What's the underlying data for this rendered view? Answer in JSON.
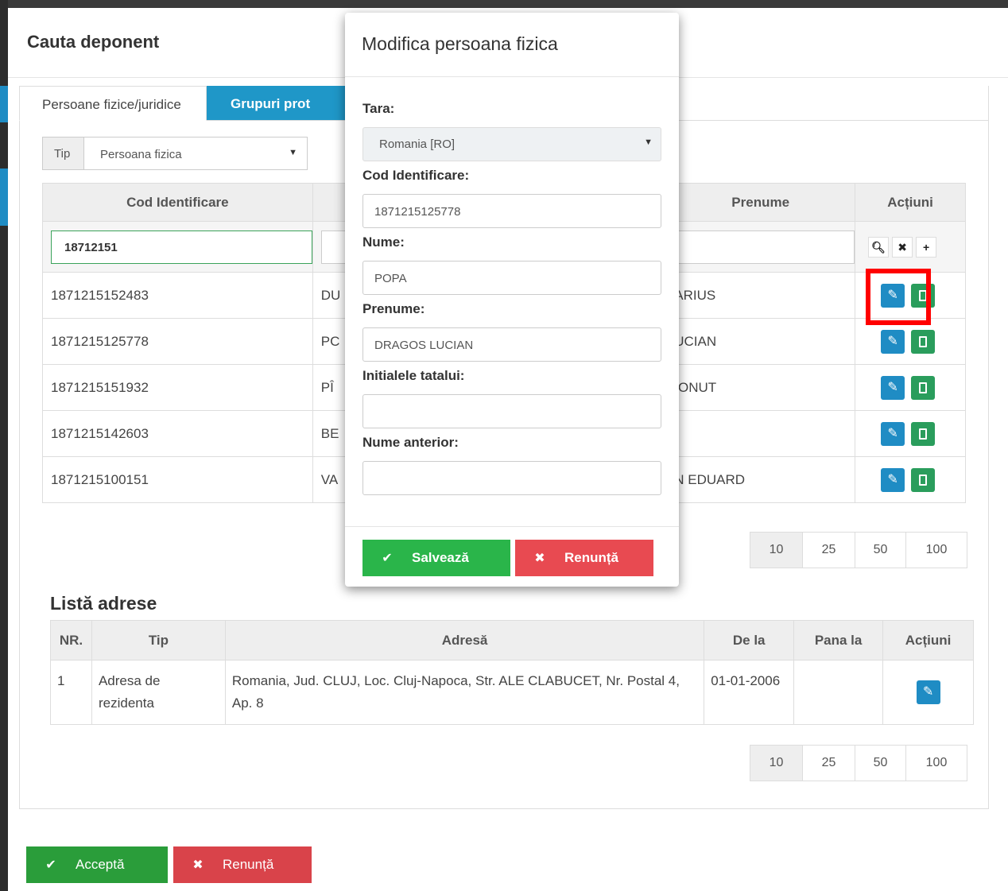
{
  "main": {
    "title": "Cauta deponent",
    "tabs": [
      {
        "label": "Persoane fizice/juridice"
      },
      {
        "label": "Grupuri prot"
      }
    ],
    "tip": {
      "label": "Tip",
      "value": "Persoana fizica"
    },
    "grid": {
      "columns": [
        "Cod Identificare",
        "",
        "Prenume",
        "Acțiuni"
      ],
      "filter": {
        "cod": "18712151"
      },
      "rows": [
        {
          "cod": "1871215152483",
          "nume": "DU",
          "prenume": "ARIUS"
        },
        {
          "cod": "1871215125778",
          "nume": "PC",
          "prenume": "UCIAN"
        },
        {
          "cod": "1871215151932",
          "nume": "PÎ",
          "prenume": "IONUT"
        },
        {
          "cod": "1871215142603",
          "nume": "BE",
          "prenume": ""
        },
        {
          "cod": "1871215100151",
          "nume": "VA",
          "prenume": "N EDUARD"
        }
      ]
    },
    "pager": [
      "10",
      "25",
      "50",
      "100"
    ],
    "addresses": {
      "title": "Listă adrese",
      "columns": [
        "NR.",
        "Tip",
        "Adresă",
        "De la",
        "Pana la",
        "Acțiuni"
      ],
      "rows": [
        {
          "nr": "1",
          "tip": "Adresa de rezidenta",
          "adresa": "Romania, Jud. CLUJ, Loc. Cluj-Napoca, Str. ALE CLABUCET, Nr. Postal 4, Ap. 8",
          "de_la": "01-01-2006",
          "pana_la": ""
        }
      ]
    },
    "buttons": {
      "accept": "Acceptă",
      "cancel": "Renunță"
    }
  },
  "modal": {
    "title": "Modifica persoana fizica",
    "fields": {
      "tara_label": "Tara:",
      "tara_value": "Romania [RO]",
      "cod_label": "Cod Identificare:",
      "cod_value": "1871215125778",
      "nume_label": "Nume:",
      "nume_value": "POPA",
      "prenume_label": "Prenume:",
      "prenume_value": "DRAGOS LUCIAN",
      "initiale_label": "Initialele tatalui:",
      "initiale_value": "",
      "anterior_label": "Nume anterior:",
      "anterior_value": ""
    },
    "buttons": {
      "save": "Salvează",
      "cancel": "Renunță"
    }
  },
  "icons": {
    "search": "search-icon",
    "clear": "clear-icon",
    "add": "plus-icon",
    "edit": "pencil-icon",
    "delete": "trash-icon",
    "check": "check-icon",
    "close": "close-icon"
  },
  "colors": {
    "primary": "#1f8cc4",
    "success": "#2a9d3a",
    "danger": "#d9434a",
    "highlight": "#ff0000"
  }
}
